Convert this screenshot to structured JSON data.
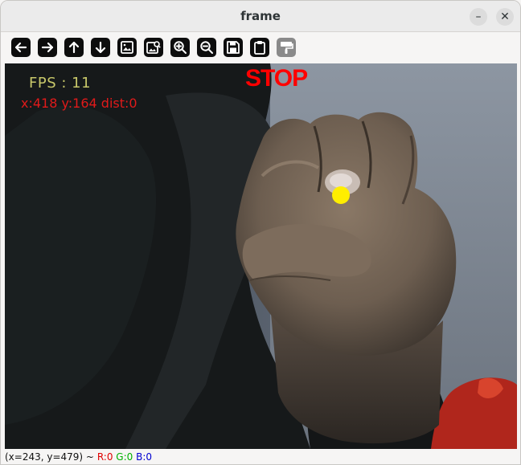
{
  "window": {
    "title": "frame",
    "minimize_label": "–",
    "close_label": "✕"
  },
  "toolbar": {
    "buttons": [
      {
        "name": "pan-left-button",
        "icon": "arrow-left-icon"
      },
      {
        "name": "pan-right-button",
        "icon": "arrow-right-icon"
      },
      {
        "name": "pan-up-button",
        "icon": "arrow-up-icon"
      },
      {
        "name": "pan-down-button",
        "icon": "arrow-down-icon"
      },
      {
        "name": "zoom-original-button",
        "icon": "image-icon"
      },
      {
        "name": "zoom-fit-button",
        "icon": "image-zoom-icon"
      },
      {
        "name": "zoom-in-button",
        "icon": "zoom-in-icon"
      },
      {
        "name": "zoom-out-button",
        "icon": "zoom-out-icon"
      },
      {
        "name": "save-button",
        "icon": "floppy-disk-icon"
      },
      {
        "name": "copy-clipboard-button",
        "icon": "clipboard-icon"
      },
      {
        "name": "properties-button",
        "icon": "paint-roller-icon"
      }
    ]
  },
  "overlay": {
    "fps": "FPS : 11",
    "coords": "x:418 y:164 dist:0",
    "gesture": "STOP",
    "fps_color": "#c8c86a",
    "coords_color": "#e01a1a",
    "gesture_color": "#ff0000",
    "marker_color": "#ffee00"
  },
  "status": {
    "position": "(x=243, y=479) ~",
    "r": "R:0",
    "g": "G:0",
    "b": "B:0"
  }
}
